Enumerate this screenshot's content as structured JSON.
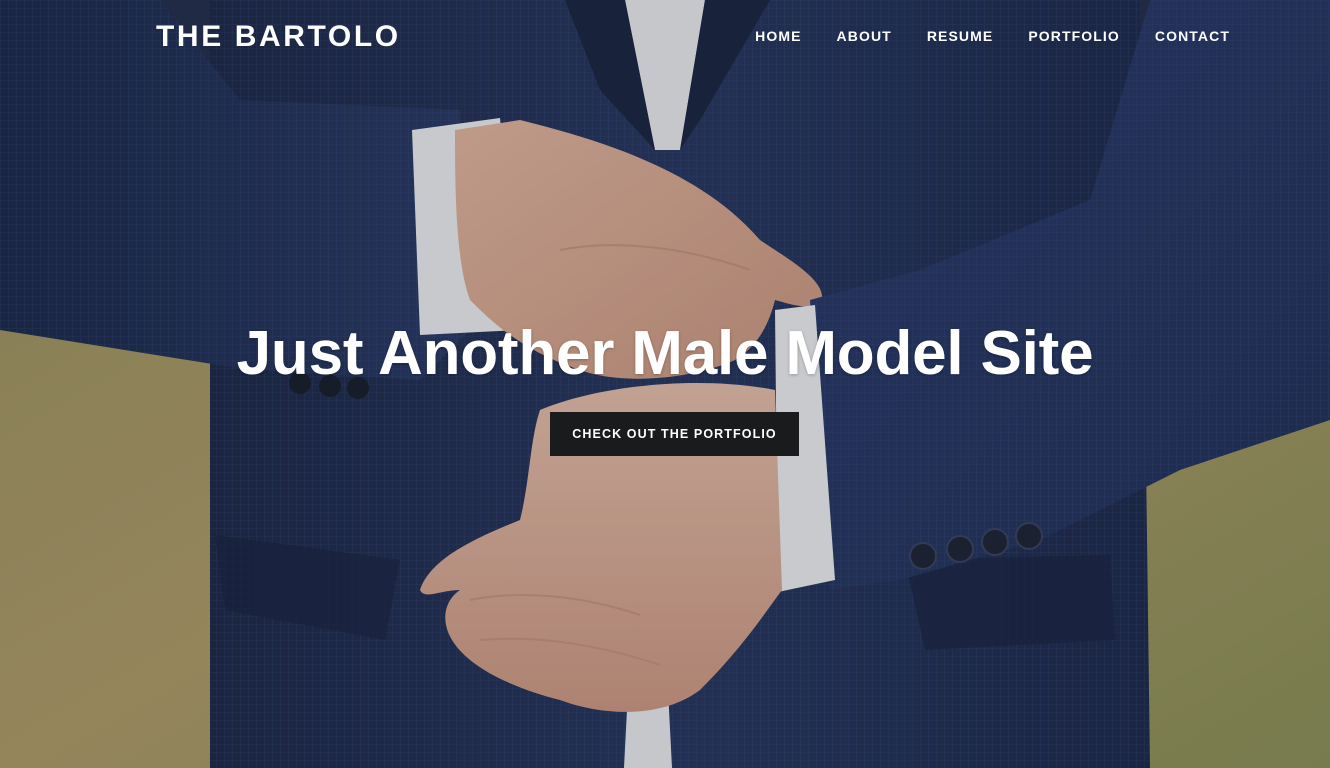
{
  "site": {
    "brand": "THE BARTOLO"
  },
  "nav": {
    "items": [
      {
        "label": "HOME"
      },
      {
        "label": "ABOUT"
      },
      {
        "label": "RESUME"
      },
      {
        "label": "PORTFOLIO"
      },
      {
        "label": "CONTACT"
      }
    ]
  },
  "hero": {
    "headline": "Just Another Male Model Site",
    "cta_label": "CHECK OUT THE PORTFOLIO",
    "image_subject": "man-in-navy-suit-adjusting-shirt-cuff"
  },
  "colors": {
    "suit": "#2a3a63",
    "background_grass": "#a89a62",
    "button_bg": "#1a1b1d",
    "text": "#ffffff"
  }
}
